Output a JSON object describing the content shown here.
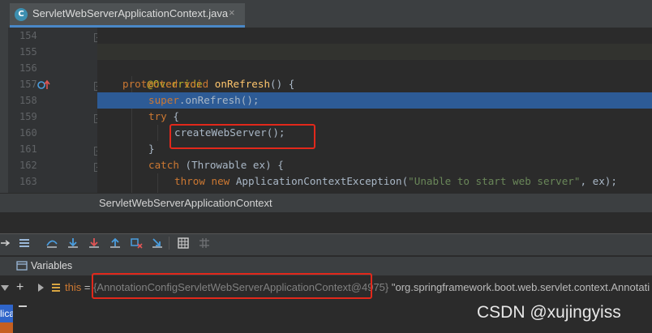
{
  "editor_tab": {
    "icon_letter": "C",
    "title": "ServletWebServerApplicationContext.java",
    "close_symbol": "×"
  },
  "gutter": {
    "line_numbers": [
      "154",
      "155",
      "156",
      "157",
      "158",
      "159",
      "160",
      "161",
      "162",
      "163"
    ]
  },
  "code": {
    "line_154": "}",
    "line_156": "@Override",
    "line_157_kw1": "protected",
    "line_157_kw2": "void",
    "line_157_fn": "onRefresh",
    "line_157_rest": "() {",
    "line_158_kw": "super",
    "line_158_rest": ".onRefresh();",
    "line_159_kw": "try",
    "line_159_rest": " {",
    "line_160": "createWebServer();",
    "line_161": "}",
    "line_162_kw": "catch",
    "line_162_rest": " (Throwable ex) {",
    "line_163_kw1": "throw",
    "line_163_kw2": "new",
    "line_163_mid": " ApplicationContextException(",
    "line_163_str": "\"Unable to start web server\"",
    "line_163_end": ", ex);"
  },
  "breadcrumb": "ServletWebServerApplicationContext",
  "debugger": {
    "toolbar_icons": [
      "step-over-icon",
      "step-into-icon",
      "force-step-into-icon",
      "step-out-icon",
      "drop-frame-icon",
      "run-to-cursor-icon",
      "evaluate-icon",
      "trace-icon"
    ],
    "variables_title": "Variables",
    "var_name": "this",
    "var_eq": " = ",
    "var_value": "{AnnotationConfigServletWebServerApplicationContext@4975}",
    "var_desc": " \"org.springframework.boot.web.servlet.context.Annotati",
    "left_tab_text": "lica"
  },
  "watermark": "CSDN @xujingyiss",
  "colors": {
    "accent": "#2d5b96",
    "highlight_box": "#e2281b",
    "keyword": "#cc7832",
    "function": "#ffc66d",
    "string": "#6a8759",
    "annotation": "#bbb529"
  }
}
